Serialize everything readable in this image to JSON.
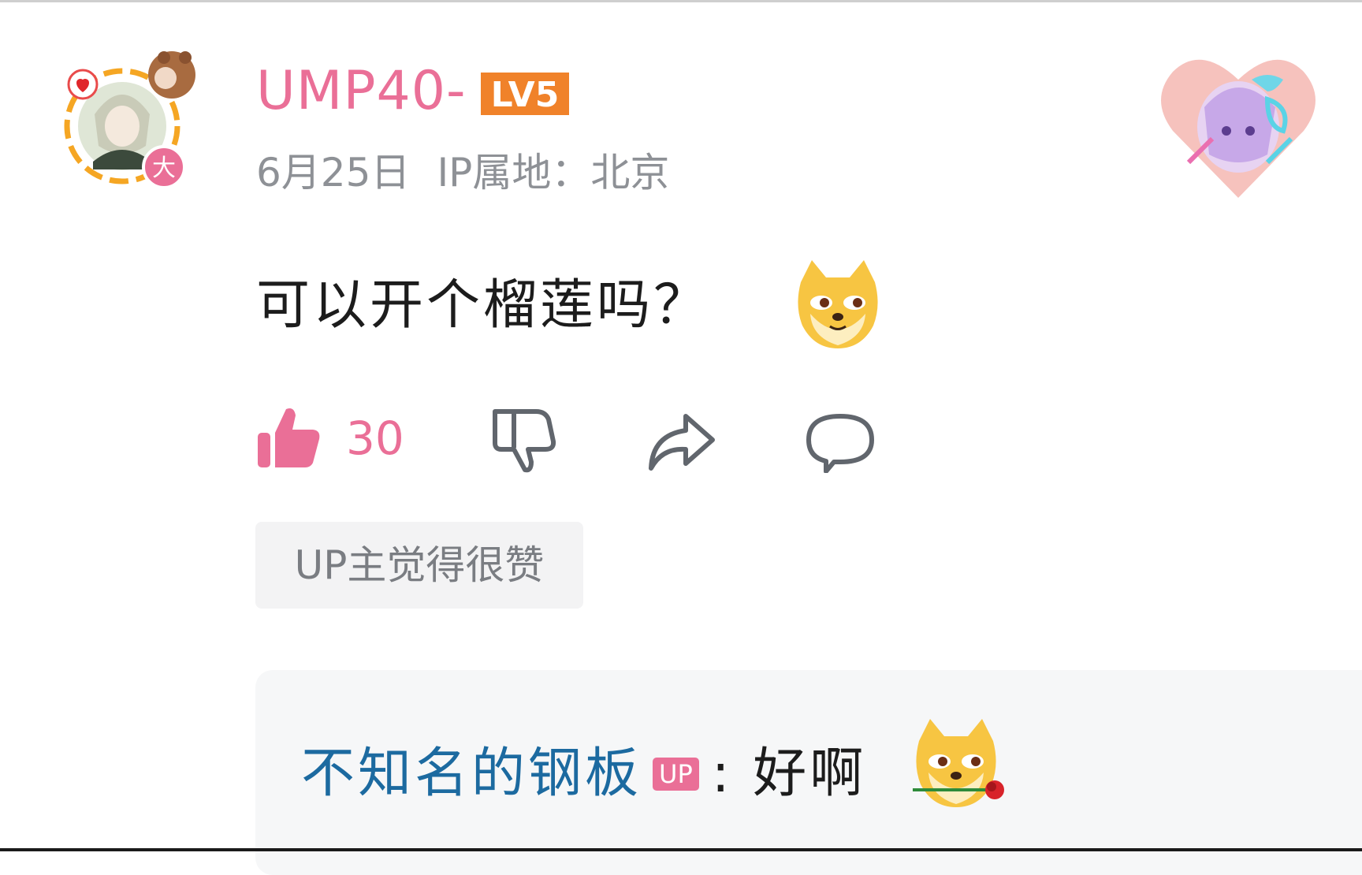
{
  "comment": {
    "username": "UMP40-",
    "level": "LV5",
    "date": "6月25日",
    "ip_location": "IP属地：北京",
    "avatar_badge": "大",
    "text": "可以开个榴莲吗？",
    "emoji": "doge-emoji",
    "like_count": "30",
    "up_tag": "UP主觉得很赞",
    "icons": [
      "like-icon",
      "dislike-icon",
      "share-icon",
      "reply-icon"
    ],
    "colors": {
      "username": "#ea6f97",
      "level_badge": "#f0822a",
      "like": "#ea6f97",
      "meta": "#8e9196"
    }
  },
  "reply": {
    "author": "不知名的钢板",
    "author_badge": "UP",
    "separator": ":",
    "text": "好啊",
    "emoji": "doge-rose-emoji",
    "colors": {
      "author": "#1c6aa0",
      "badge": "#ea6f97"
    }
  }
}
